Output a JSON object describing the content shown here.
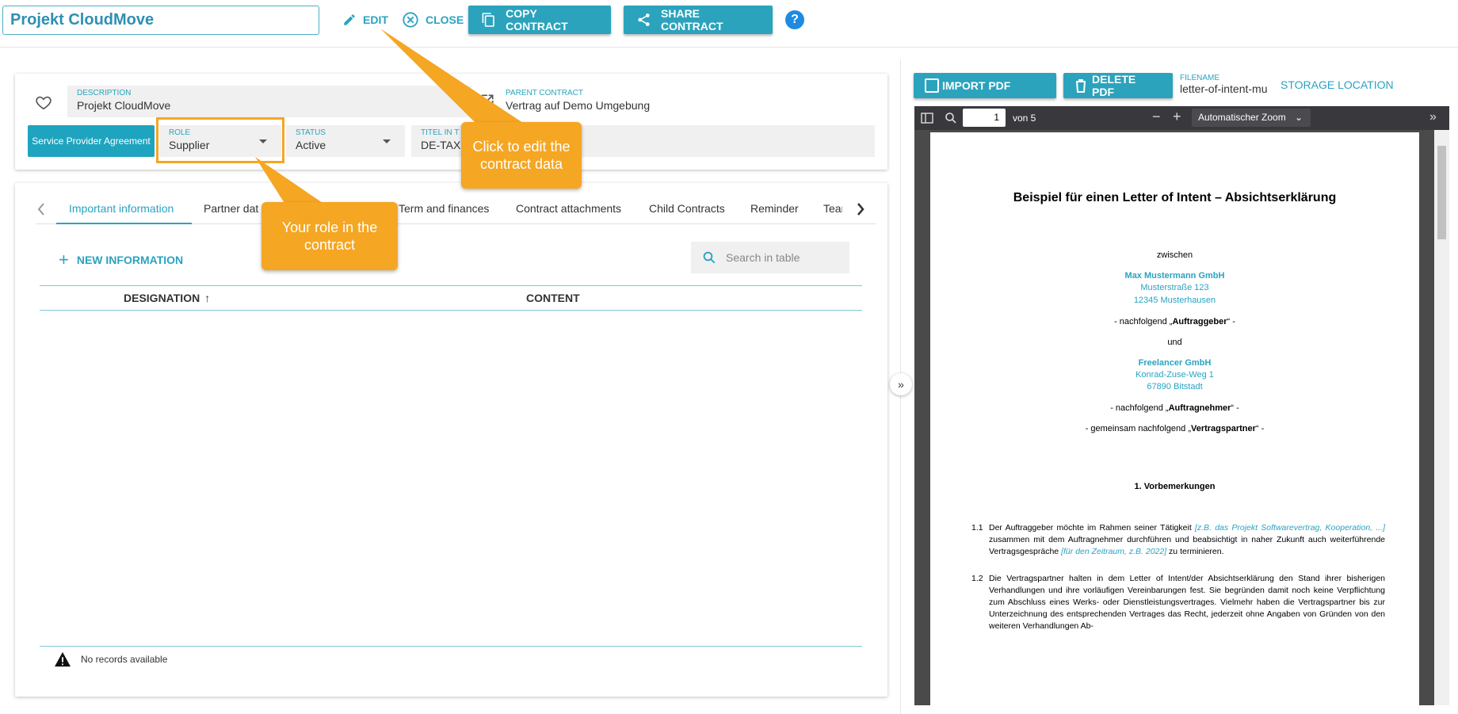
{
  "header": {
    "project_title": "Projekt CloudMove",
    "edit_label": "EDIT",
    "close_label": "CLOSE",
    "copy_label": "COPY CONTRACT",
    "share_label": "SHARE CONTRACT",
    "help_label": "?"
  },
  "details": {
    "description_label": "DESCRIPTION",
    "description_value": "Projekt CloudMove",
    "parent_label": "PARENT CONTRACT",
    "parent_value": "Vertrag auf Demo Umgebung",
    "type_tag": "Service Provider Agreement",
    "role_label": "ROLE",
    "role_value": "Supplier",
    "status_label": "STATUS",
    "status_value": "Active",
    "title_label": "TITEL IN T",
    "title_value": "DE-TAXI"
  },
  "tabs": [
    "Important information",
    "Partner dat",
    "Term and finances",
    "Contract attachments",
    "Child Contracts",
    "Reminder",
    "Tean"
  ],
  "table": {
    "new_label": "NEW INFORMATION",
    "search_placeholder": "Search in table",
    "col_designation": "DESIGNATION",
    "col_content": "CONTENT",
    "empty": "No records available"
  },
  "callouts": {
    "edit": "Click to edit the contract data",
    "role": "Your role in the contract"
  },
  "pdf": {
    "import_label": "IMPORT PDF",
    "delete_label": "DELETE PDF",
    "filename_label": "FILENAME",
    "filename_value": "letter-of-intent-mu",
    "storage_label": "STORAGE LOCATION",
    "page_number": "1",
    "page_count": "von 5",
    "zoom": "Automatischer Zoom",
    "doc": {
      "title": "Beispiel für einen Letter of Intent – Absichtserklärung",
      "between": "zwischen",
      "party1_name": "Max Mustermann GmbH",
      "party1_street": "Musterstraße 123",
      "party1_city": "12345 Musterhausen",
      "party1_role_pre": "- nachfolgend „",
      "party1_role": "Auftraggeber",
      "party1_role_post": "“ -",
      "and": "und",
      "party2_name": "Freelancer GmbH",
      "party2_street": "Konrad-Zuse-Weg 1",
      "party2_city": "67890 Bitstadt",
      "party2_role_pre": "- nachfolgend „",
      "party2_role": "Auftragnehmer",
      "party2_role_post": "“ -",
      "joint_pre": "- gemeinsam nachfolgend „",
      "joint": "Vertragspartner",
      "joint_post": "“ -",
      "section": "1.   Vorbemerkungen",
      "p1_num": "1.1",
      "p1_a": "Der Auftraggeber möchte im Rahmen seiner Tätigkeit ",
      "p1_b": "[z.B. das Projekt Softwarevertrag, Kooperation, ...]",
      "p1_c": " zusammen mit dem Auftragnehmer durchführen und beabsichtigt in naher Zukunft auch weiterführende Vertragsgespräche ",
      "p1_d": "[für den Zeitraum, z.B. 2022]",
      "p1_e": " zu terminieren.",
      "p2_num": "1.2",
      "p2": "Die Vertragspartner halten in dem Letter of Intent/der Absichtserklärung den Stand ihrer bisherigen Verhandlungen und ihre vorläufigen Vereinbarungen fest. Sie begründen damit noch keine Verpflichtung zum Abschluss eines Werks- oder Dienstleistungsvertrages. Vielmehr haben die Vertragspartner bis zur Unterzeichnung des entsprechenden Vertrages das Recht, jederzeit ohne Angaben von Gründen von den weiteren Verhandlungen Ab-"
    }
  },
  "colors": {
    "accent": "#2ba3bd",
    "callout": "#f5a623"
  }
}
